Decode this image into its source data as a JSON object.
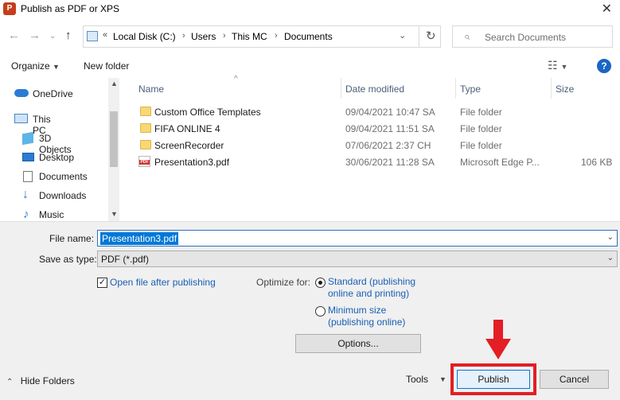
{
  "window": {
    "title": "Publish as PDF or XPS",
    "app_icon": "P"
  },
  "nav": {
    "breadcrumbs": [
      "Local Disk (C:)",
      "Users",
      "This MC",
      "Documents"
    ],
    "search_placeholder": "Search Documents"
  },
  "toolbar": {
    "organize": "Organize",
    "new_folder": "New folder"
  },
  "sidebar": {
    "items": [
      {
        "label": "OneDrive",
        "icon": "cloud-icon"
      },
      {
        "label": "This PC",
        "icon": "pc-icon"
      },
      {
        "label": "3D Objects",
        "icon": "cube-icon"
      },
      {
        "label": "Desktop",
        "icon": "desktop-icon"
      },
      {
        "label": "Documents",
        "icon": "documents-icon"
      },
      {
        "label": "Downloads",
        "icon": "download-icon"
      },
      {
        "label": "Music",
        "icon": "music-icon"
      }
    ]
  },
  "files": {
    "columns": [
      "Name",
      "Date modified",
      "Type",
      "Size"
    ],
    "rows": [
      {
        "name": "Custom Office Templates",
        "date": "09/04/2021 10:47 SA",
        "type": "File folder",
        "size": "",
        "icon": "folder-icon"
      },
      {
        "name": "FIFA ONLINE 4",
        "date": "09/04/2021 11:51 SA",
        "type": "File folder",
        "size": "",
        "icon": "folder-icon"
      },
      {
        "name": "ScreenRecorder",
        "date": "07/06/2021 2:37 CH",
        "type": "File folder",
        "size": "",
        "icon": "folder-icon"
      },
      {
        "name": "Presentation3.pdf",
        "date": "30/06/2021 11:28 SA",
        "type": "Microsoft Edge P...",
        "size": "106 KB",
        "icon": "pdf-icon"
      }
    ]
  },
  "form": {
    "file_name_label": "File name:",
    "file_name_value": "Presentation3.pdf",
    "save_type_label": "Save as type:",
    "save_type_value": "PDF (*.pdf)",
    "open_after_label": "Open file after publishing",
    "optimize_label": "Optimize for:",
    "standard_line1": "Standard (publishing",
    "standard_line2": "online and printing)",
    "minimum_line1": "Minimum size",
    "minimum_line2": "(publishing online)",
    "options_button": "Options...",
    "hide_folders": "Hide Folders",
    "tools": "Tools",
    "publish_button": "Publish",
    "cancel_button": "Cancel"
  },
  "colors": {
    "highlight": "#e31e24",
    "accent": "#0078d7"
  }
}
